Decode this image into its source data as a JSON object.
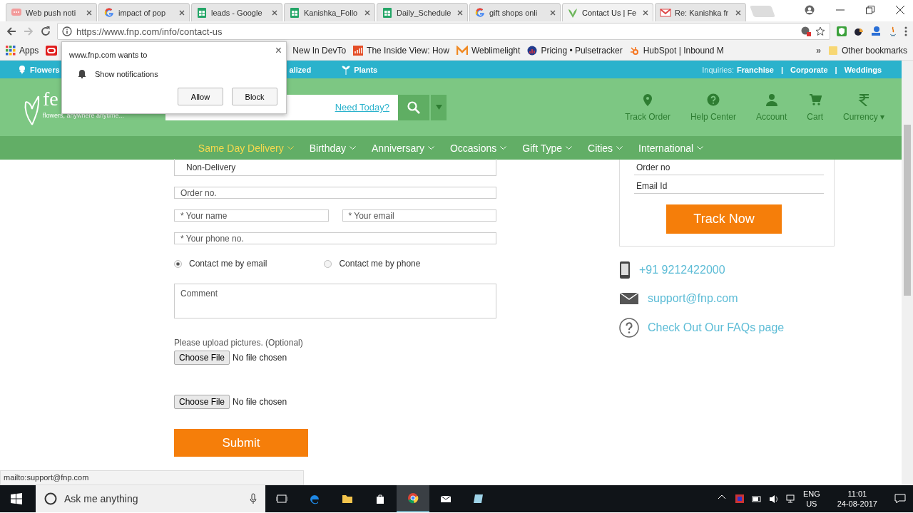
{
  "browser": {
    "tabs": [
      {
        "title": "Web push noti",
        "kind": "push",
        "selected": false
      },
      {
        "title": "impact of pop",
        "kind": "google",
        "selected": false
      },
      {
        "title": "leads - Google",
        "kind": "sheets",
        "selected": false
      },
      {
        "title": "Kanishka_Follo",
        "kind": "sheets",
        "selected": false
      },
      {
        "title": "Daily_Schedule",
        "kind": "sheets",
        "selected": false
      },
      {
        "title": "gift shops onli",
        "kind": "google",
        "selected": false
      },
      {
        "title": "Contact Us | Fe",
        "kind": "fnp",
        "selected": true
      },
      {
        "title": "Re: Kanishka fr",
        "kind": "gmail",
        "selected": false
      }
    ],
    "url": "https://www.fnp.com/info/contact-us",
    "bookmarks": [
      {
        "label": "Apps",
        "kind": "apps"
      },
      {
        "kind": "oracle"
      },
      {
        "label": "New In DevTo",
        "kind": "none"
      },
      {
        "label": "The Inside View: How",
        "kind": "chart"
      },
      {
        "label": "Weblimelight",
        "kind": "m"
      },
      {
        "label": "Pricing • Pulsetracker",
        "kind": "gauge"
      },
      {
        "label": "HubSpot | Inbound M",
        "kind": "hub"
      }
    ],
    "more": "»",
    "other_bookmarks": "Other bookmarks"
  },
  "popup": {
    "title": "www.fnp.com wants to",
    "close": "×",
    "permission": "Show notifications",
    "buttons": [
      "Allow",
      "Block"
    ]
  },
  "site": {
    "top_links": [
      {
        "label": "Flowers",
        "kind": "flower"
      },
      {
        "label": "alized",
        "kind": "none"
      },
      {
        "label": "Plants",
        "kind": "plant"
      }
    ],
    "inquiries": "Inquiries:",
    "inquiry_links": [
      "Franchise",
      "Corporate",
      "Weddings"
    ],
    "inquiry_separators": [
      "|",
      "|"
    ],
    "logo": "fe",
    "tagline": "flowers, anywhere anytime...",
    "need_today": "Need Today?",
    "header_actions": [
      {
        "label": "Track Order",
        "kind": "pin"
      },
      {
        "label": "Help Center",
        "kind": "help"
      },
      {
        "label": "Account",
        "kind": "user"
      },
      {
        "label": "Cart",
        "kind": "cart"
      },
      {
        "label": "Currency ▾",
        "kind": "rupee"
      }
    ],
    "nav": [
      {
        "label": "Same Day Delivery",
        "selected": true
      },
      {
        "label": "Birthday",
        "selected": false
      },
      {
        "label": "Anniversary",
        "selected": false
      },
      {
        "label": "Occasions",
        "selected": false
      },
      {
        "label": "Gift Type",
        "selected": false
      },
      {
        "label": "Cities",
        "selected": false
      },
      {
        "label": "International",
        "selected": false
      }
    ]
  },
  "form": {
    "issue": "Non-Delivery",
    "order_placeholder": "Order no.",
    "name_placeholder": "* Your name",
    "email_placeholder": "* Your email",
    "phone_placeholder": "* Your phone no.",
    "contact_options": [
      {
        "label": "Contact me by email",
        "selected": true
      },
      {
        "label": "Contact me by phone",
        "selected": false
      }
    ],
    "comment_placeholder": "Comment",
    "upload_label": "Please upload pictures. (Optional)",
    "uploads": [
      {
        "button": "Choose File",
        "status": "No file chosen"
      },
      {
        "button": "Choose File",
        "status": "No file chosen"
      }
    ],
    "submit": "Submit"
  },
  "track": {
    "order_placeholder": "Order no",
    "email_placeholder": "Email Id",
    "button": "Track Now"
  },
  "contacts": [
    {
      "kind": "phone",
      "text": "+91 9212422000"
    },
    {
      "kind": "mail",
      "text": "support@fnp.com"
    },
    {
      "kind": "faq",
      "text": "Check Out Our FAQs page"
    }
  ],
  "status_tip": "mailto:support@fnp.com",
  "taskbar": {
    "search": "Ask me anything",
    "lang": "ENG",
    "region": "US",
    "time": "11:01",
    "date": "24-08-2017"
  }
}
